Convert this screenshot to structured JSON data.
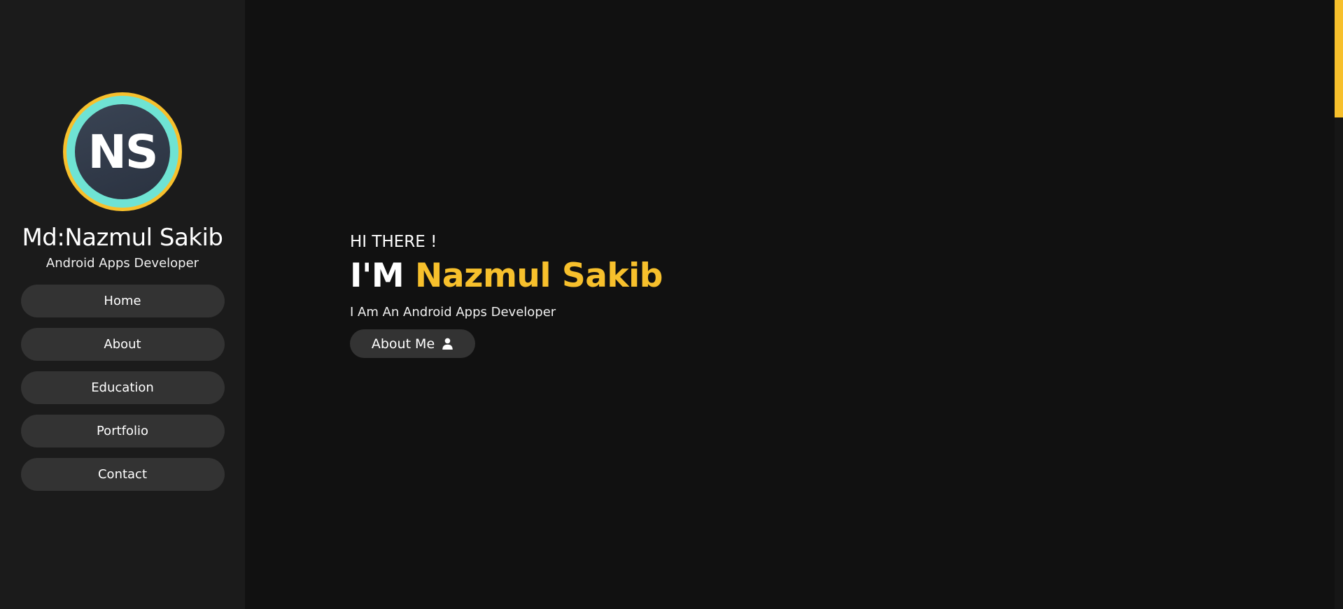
{
  "profile": {
    "avatar_initials": "NS",
    "name": "Md:Nazmul Sakib",
    "role": "Android Apps Developer"
  },
  "nav": {
    "items": [
      {
        "label": "Home"
      },
      {
        "label": "About"
      },
      {
        "label": "Education"
      },
      {
        "label": "Portfolio"
      },
      {
        "label": "Contact"
      }
    ]
  },
  "hero": {
    "greeting": "HI THERE !",
    "headline_prefix": "I'M",
    "headline_name": "Nazmul Sakib",
    "tagline": "I Am An Android Apps Developer",
    "button_label": "About Me",
    "button_icon": "user-icon"
  },
  "colors": {
    "accent": "#f7c02c",
    "avatar_ring": "#6fe3d3",
    "background": "#111111",
    "sidebar": "#1b1b1b",
    "button": "#333333"
  }
}
